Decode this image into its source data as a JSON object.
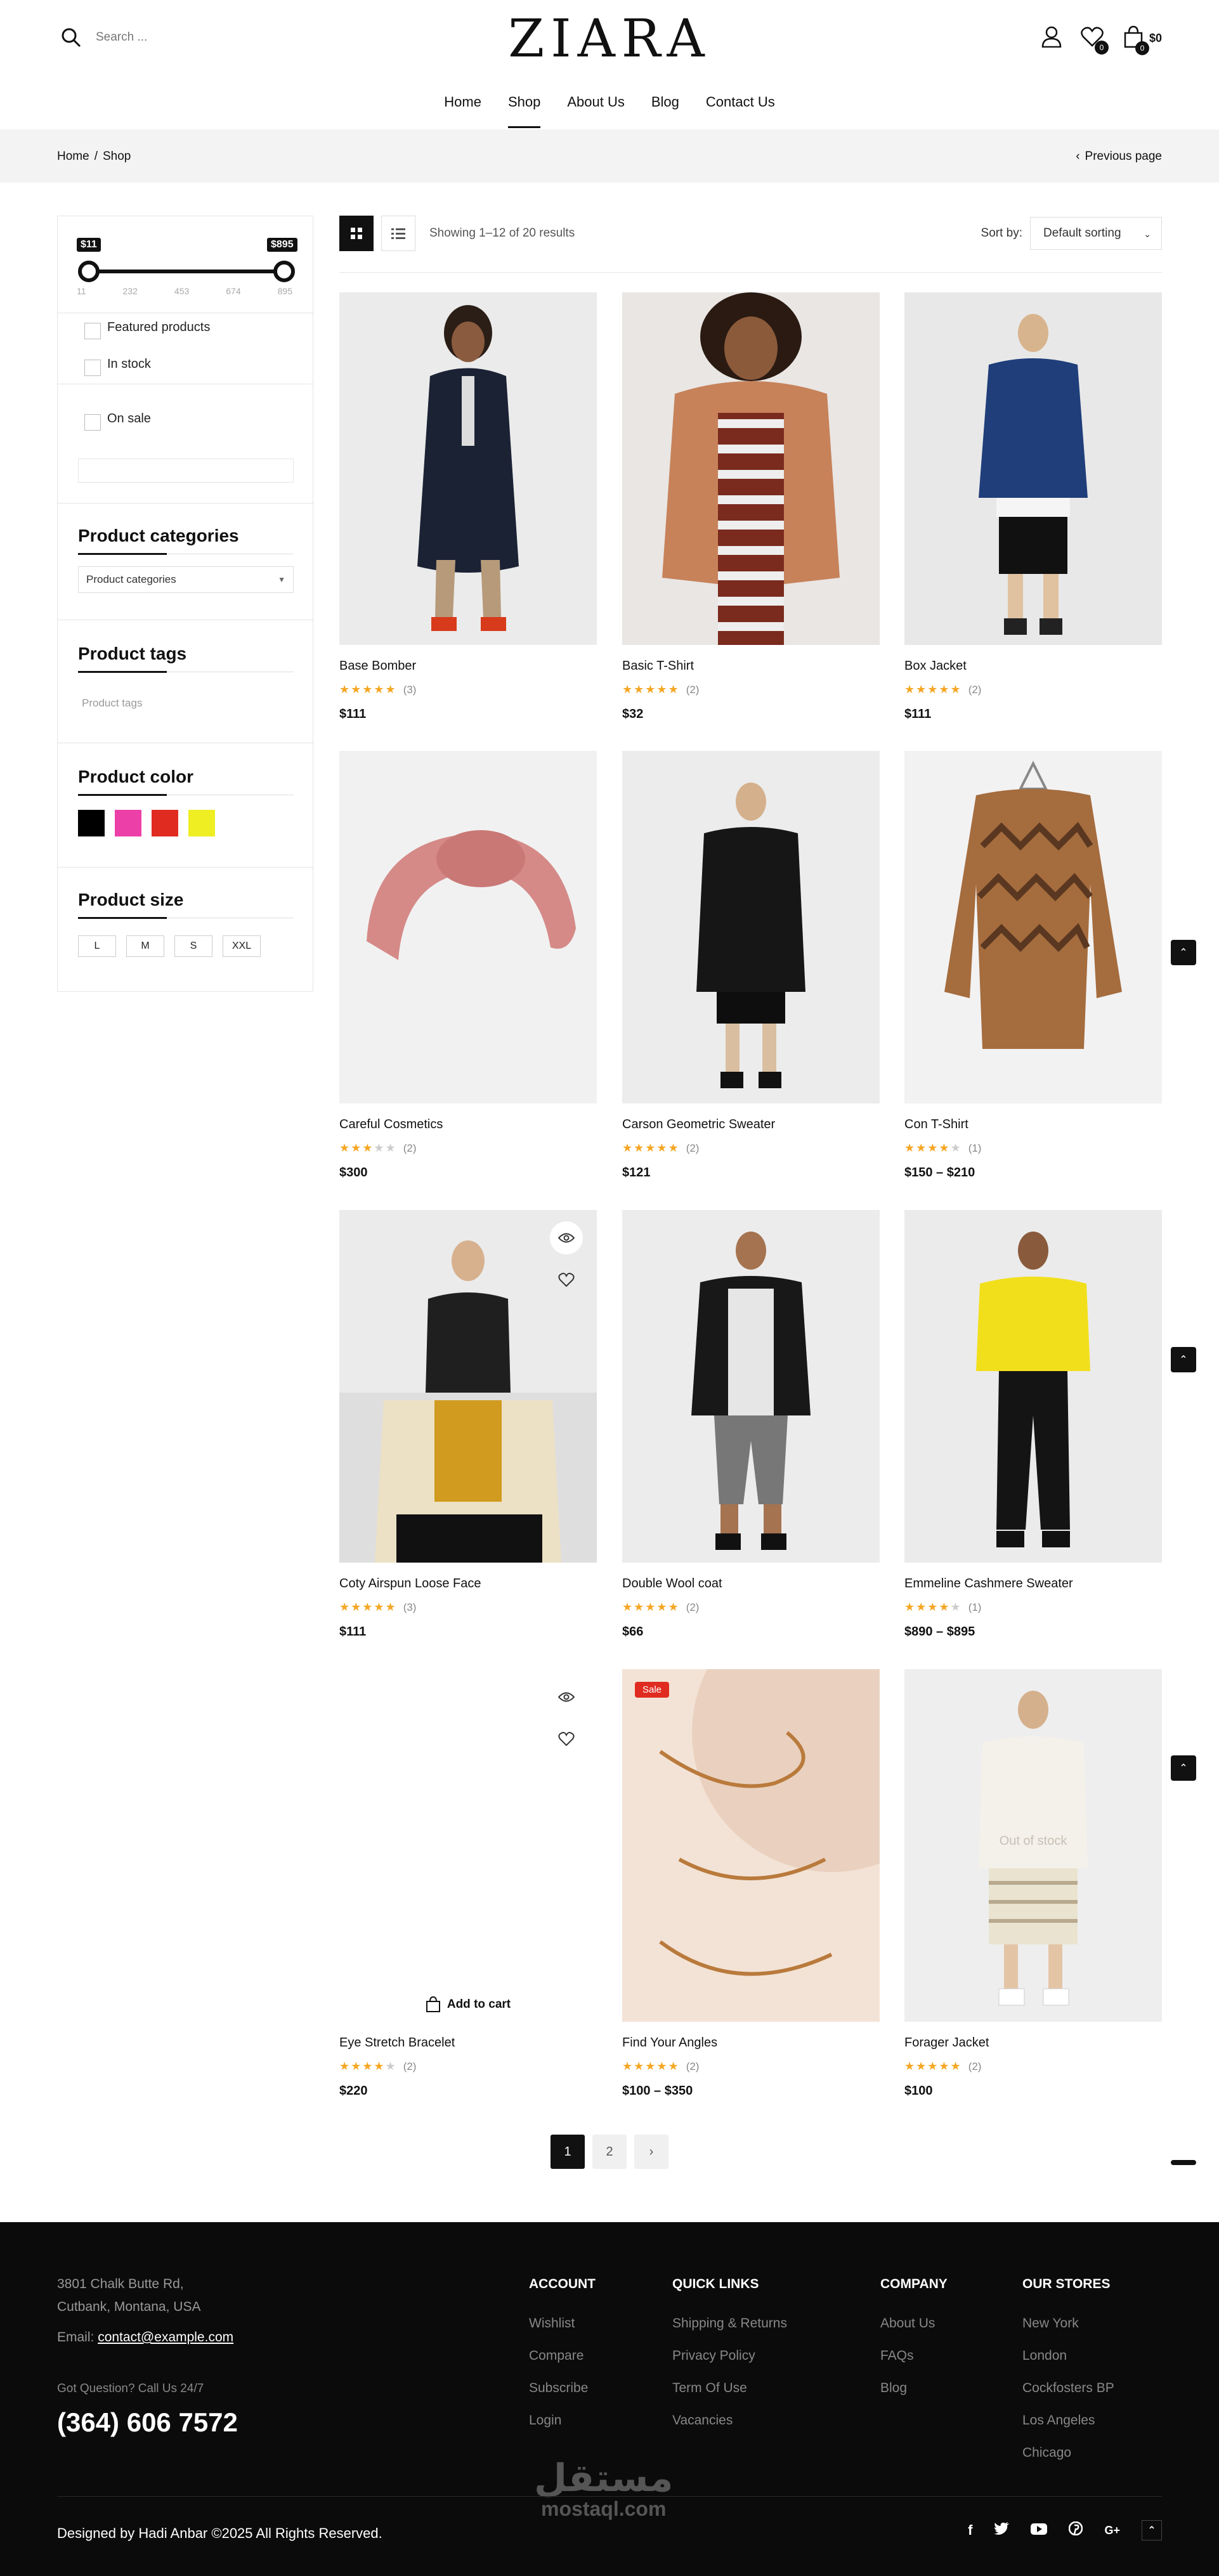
{
  "header": {
    "search_placeholder": "Search ...",
    "logo": "ZIARA",
    "wishlist_count": "0",
    "cart_count": "0",
    "cart_total": "$0"
  },
  "nav": [
    {
      "label": "Home"
    },
    {
      "label": "Shop",
      "active": true
    },
    {
      "label": "About Us"
    },
    {
      "label": "Blog"
    },
    {
      "label": "Contact Us"
    }
  ],
  "breadcrumb": {
    "home": "Home",
    "sep": "/",
    "current": "Shop",
    "prev": "Previous page"
  },
  "sidebar": {
    "price_min_label": "$11",
    "price_max_label": "$895",
    "ticks": [
      "11",
      "232",
      "453",
      "674",
      "895"
    ],
    "filters": [
      "Featured products",
      "In stock",
      "On sale"
    ],
    "categories_title": "Product categories",
    "categories_select": "Product categories",
    "tags_title": "Product tags",
    "tags_placeholder": "Product tags",
    "color_title": "Product color",
    "colors": [
      "#000000",
      "#ec3fa8",
      "#e02b20",
      "#eeee22"
    ],
    "size_title": "Product size",
    "sizes": [
      "L",
      "M",
      "S",
      "XXL"
    ]
  },
  "toolbar": {
    "result_text": "Showing 1–12 of 20 results",
    "sort_label": "Sort by:",
    "sort_value": "Default sorting"
  },
  "products": [
    {
      "name": "Base Bomber",
      "rating": 5,
      "count": "(3)",
      "price": "$111"
    },
    {
      "name": "Basic T-Shirt",
      "rating": 5,
      "count": "(2)",
      "price": "$32"
    },
    {
      "name": "Box Jacket",
      "rating": 5,
      "count": "(2)",
      "price": "$111"
    },
    {
      "name": "Careful Cosmetics",
      "rating": 3,
      "count": "(2)",
      "price": "$300"
    },
    {
      "name": "Carson Geometric Sweater",
      "rating": 5,
      "count": "(2)",
      "price": "$121"
    },
    {
      "name": "Con T-Shirt",
      "rating": 4,
      "count": "(1)",
      "price": "$150 – $210"
    },
    {
      "name": "Coty Airspun Loose Face",
      "rating": 5,
      "count": "(3)",
      "price": "$111"
    },
    {
      "name": "Double Wool coat",
      "rating": 5,
      "count": "(2)",
      "price": "$66"
    },
    {
      "name": "Emmeline Cashmere Sweater",
      "rating": 4,
      "count": "(1)",
      "price": "$890 – $895"
    },
    {
      "name": "Eye Stretch Bracelet",
      "rating": 4,
      "count": "(2)",
      "price": "$220"
    },
    {
      "name": "Find Your Angles",
      "rating": 5,
      "count": "(2)",
      "price": "$100 – $350",
      "sale": "Sale"
    },
    {
      "name": "Forager Jacket",
      "rating": 5,
      "count": "(2)",
      "price": "$100",
      "oos": "Out of stock"
    }
  ],
  "add_to_cart": "Add to cart",
  "pagination": [
    "1",
    "2"
  ],
  "footer": {
    "address_line1": "3801 Chalk Butte Rd,",
    "address_line2": "Cutbank, Montana, USA",
    "email_label": "Email:",
    "email": "contact@example.com",
    "question": "Got Question? Call Us 24/7",
    "phone": "(364) 606 7572",
    "columns": [
      {
        "title": "ACCOUNT",
        "links": [
          "Wishlist",
          "Compare",
          "Subscribe",
          "Login"
        ]
      },
      {
        "title": "QUICK LINKS",
        "links": [
          "Shipping & Returns",
          "Privacy Policy",
          "Term Of Use",
          "Vacancies"
        ]
      },
      {
        "title": "COMPANY",
        "links": [
          "About Us",
          "FAQs",
          "Blog"
        ]
      },
      {
        "title": "OUR STORES",
        "links": [
          "New York",
          "London",
          "Cockfosters BP",
          "Los Angeles",
          "Chicago"
        ]
      }
    ],
    "copyright": "Designed by Hadi Anbar ©2025 All Rights Reserved.",
    "watermark_ar": "مستقل",
    "watermark_en": "mostaql.com"
  },
  "colors": {
    "accent": "#111111",
    "star": "#f5a623",
    "sale": "#e02b20",
    "footer_bg": "#0b0b0b"
  }
}
